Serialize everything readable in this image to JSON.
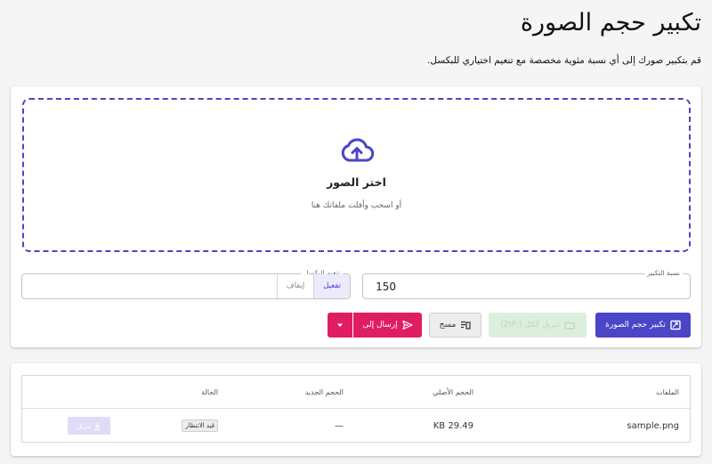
{
  "header": {
    "title": "تكبير حجم الصورة",
    "subtitle": "قم بتكبير صورك إلى أي نسبة مئوية مخصصة مع تنعيم اختياري للبكسل."
  },
  "dropzone": {
    "icon": "cloud-upload-icon",
    "title": "اختر الصور",
    "hint": "أو اسحب وأفلت ملفاتك هنا"
  },
  "controls": {
    "scale": {
      "label": "نسبة التكبير",
      "value": "150"
    },
    "smoothing": {
      "label": "تنعيم البكسل",
      "options": [
        "تفعيل",
        "إيقاف"
      ],
      "selected": "تفعيل"
    }
  },
  "actions": {
    "resize_label": "تكبير حجم الصورة",
    "zip_label": "تنزيل الكل (.ZIP)",
    "clear_label": "مسح",
    "send_label": "إرسال إلى"
  },
  "files_table": {
    "headers": [
      "الملفات",
      "الحجم الأصلي",
      "الحجم الجديد",
      "الحالة"
    ],
    "rows": [
      {
        "name": "sample.png",
        "original_size": "29.49 KB",
        "new_size": "—",
        "status": "قيد الانتظار",
        "download_label": "تنزيل"
      }
    ]
  },
  "colors": {
    "primary": "#4b45c7",
    "send": "#e01d62",
    "zip_disabled": "#dcefdc",
    "background": "#f5f5f5"
  }
}
